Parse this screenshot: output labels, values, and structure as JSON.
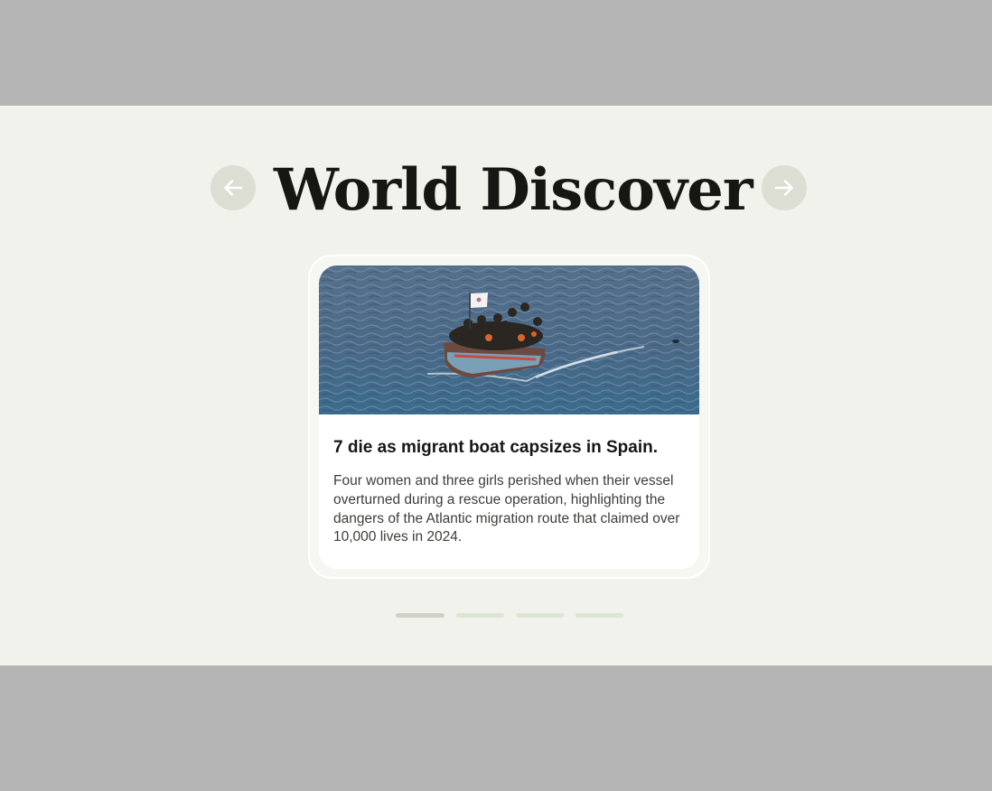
{
  "carousel": {
    "title": "World Discover",
    "prev_icon": "arrow-left-icon",
    "next_icon": "arrow-right-icon",
    "active_index": 0,
    "slide_count": 4
  },
  "card": {
    "image_alt": "Crowded migrant boat on open sea",
    "headline": "7 die as migrant boat capsizes in Spain.",
    "description": "Four women and three girls perished when their vessel overturned during a rescue operation, highlighting the dangers of the Atlantic migration route that claimed over 10,000 lives in 2024."
  },
  "colors": {
    "band_background": "#f2f2ec",
    "outer_background": "#b4b4b4",
    "nav_button": "#dcddd3",
    "title_text": "#161712",
    "dot_active": "#cfd0c6",
    "dot_inactive": "#dde5d4"
  }
}
